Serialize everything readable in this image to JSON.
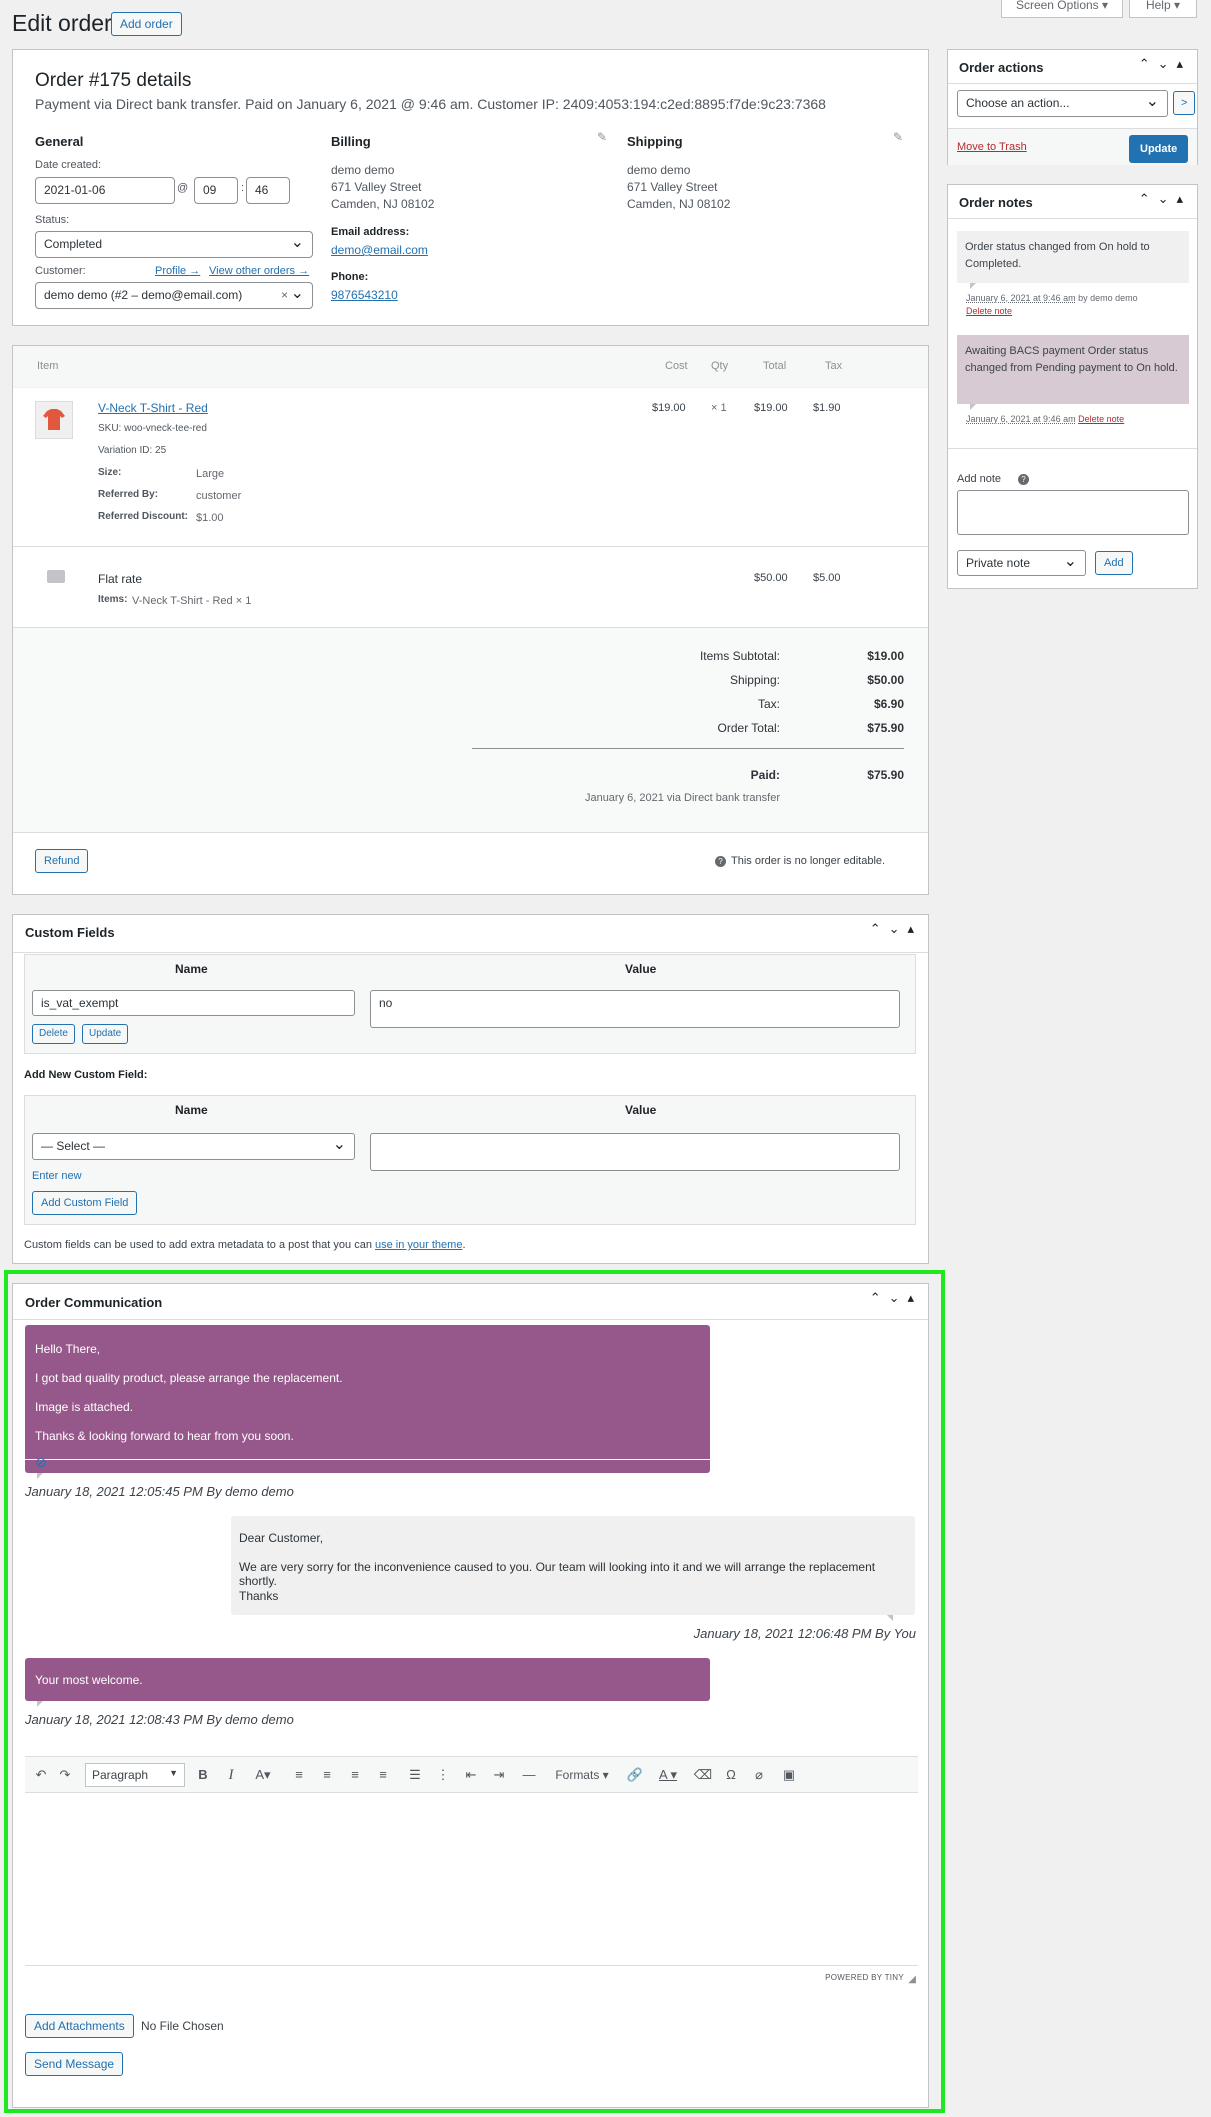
{
  "header": {
    "title": "Edit order",
    "add_order": "Add order",
    "screen_options": "Screen Options ▾",
    "help": "Help ▾"
  },
  "order": {
    "title": "Order #175 details",
    "meta": "Payment via Direct bank transfer. Paid on January 6, 2021 @ 9:46 am. Customer IP: 2409:4053:194:c2ed:8895:f7de:9c23:7368",
    "general_label": "General",
    "date_created_label": "Date created:",
    "date": "2021-01-06",
    "at": "@",
    "hour": "09",
    "colon": ":",
    "minute": "46",
    "status_label": "Status:",
    "status": "Completed",
    "customer_label": "Customer:",
    "profile_link": "Profile →",
    "view_orders_link": "View other orders →",
    "customer": "demo demo (#2 – demo@email.com)",
    "clear": "×",
    "billing_label": "Billing",
    "billing_name": "demo demo",
    "billing_street": "671 Valley Street",
    "billing_city": "Camden, NJ 08102",
    "email_label": "Email address:",
    "email": "demo@email.com",
    "phone_label": "Phone:",
    "phone": "9876543210",
    "shipping_label": "Shipping",
    "shipping_name": "demo demo",
    "shipping_street": "671 Valley Street",
    "shipping_city": "Camden, NJ 08102"
  },
  "items": {
    "headers": {
      "item": "Item",
      "cost": "Cost",
      "qty": "Qty",
      "total": "Total",
      "tax": "Tax"
    },
    "product": {
      "name": "V-Neck T-Shirt - Red",
      "sku": "SKU: woo-vneck-tee-red",
      "variation": "Variation ID: 25",
      "size_label": "Size:",
      "size": "Large",
      "ref_by_label": "Referred By:",
      "ref_by": "customer",
      "ref_disc_label": "Referred Discount:",
      "ref_disc": "$1.00",
      "cost": "$19.00",
      "qty": "× 1",
      "total": "$19.00",
      "tax": "$1.90"
    },
    "shipping": {
      "name": "Flat rate",
      "items_label": "Items:",
      "items": "V-Neck T-Shirt - Red × 1",
      "total": "$50.00",
      "tax": "$5.00"
    },
    "totals": {
      "subtotal_label": "Items Subtotal:",
      "subtotal": "$19.00",
      "shipping_label": "Shipping:",
      "shipping": "$50.00",
      "tax_label": "Tax:",
      "tax": "$6.90",
      "order_total_label": "Order Total:",
      "order_total": "$75.90",
      "paid_label": "Paid:",
      "paid": "$75.90",
      "paid_note": "January 6, 2021 via Direct bank transfer"
    },
    "refund": "Refund",
    "not_editable": "This order is no longer editable."
  },
  "custom_fields": {
    "title": "Custom Fields",
    "name_col": "Name",
    "value_col": "Value",
    "field_name": "is_vat_exempt",
    "field_value": "no",
    "delete": "Delete",
    "update": "Update",
    "add_new_label": "Add New Custom Field:",
    "select": "— Select —",
    "enter_new": "Enter new",
    "add_btn": "Add Custom Field",
    "help_text": "Custom fields can be used to add extra metadata to a post that you can ",
    "help_link": "use in your theme",
    "help_end": "."
  },
  "communication": {
    "title": "Order Communication",
    "msg1": {
      "l1": "Hello There,",
      "l2": "I got bad quality product, please arrange the replacement.",
      "l3": "Image is attached.",
      "l4": "Thanks & looking forward to hear from you soon.",
      "ts": "January 18, 2021 12:05:45 PM By demo demo"
    },
    "msg2": {
      "l1": "Dear Customer,",
      "l2": "We are very sorry for the inconvenience caused to you. Our team will looking into it and we will arrange the replacement shortly.",
      "l3": "Thanks",
      "ts": "January 18, 2021 12:06:48 PM By You"
    },
    "msg3": {
      "l1": "Your most welcome.",
      "ts": "January 18, 2021 12:08:43 PM By demo demo"
    },
    "editor": {
      "format": "Paragraph",
      "formats": "Formats",
      "powered": "POWERED BY TINY"
    },
    "add_attachments": "Add Attachments",
    "no_file": "No File Chosen",
    "send": "Send Message",
    "highlight_color": "#1ee81e"
  },
  "actions": {
    "title": "Order actions",
    "choose": "Choose an action...",
    "go": ">",
    "trash": "Move to Trash",
    "update": "Update"
  },
  "notes": {
    "title": "Order notes",
    "n1": {
      "text": "Order status changed from On hold to Completed.",
      "meta_date": "January 6, 2021 at 9:46 am",
      "meta_by": " by demo demo",
      "delete": "Delete note"
    },
    "n2": {
      "text": "Awaiting BACS payment Order status changed from Pending payment to On hold.",
      "meta_date": "January 6, 2021 at 9:46 am",
      "delete": "Delete note"
    },
    "add_label": "Add note",
    "help": "?",
    "type": "Private note",
    "add": "Add"
  }
}
